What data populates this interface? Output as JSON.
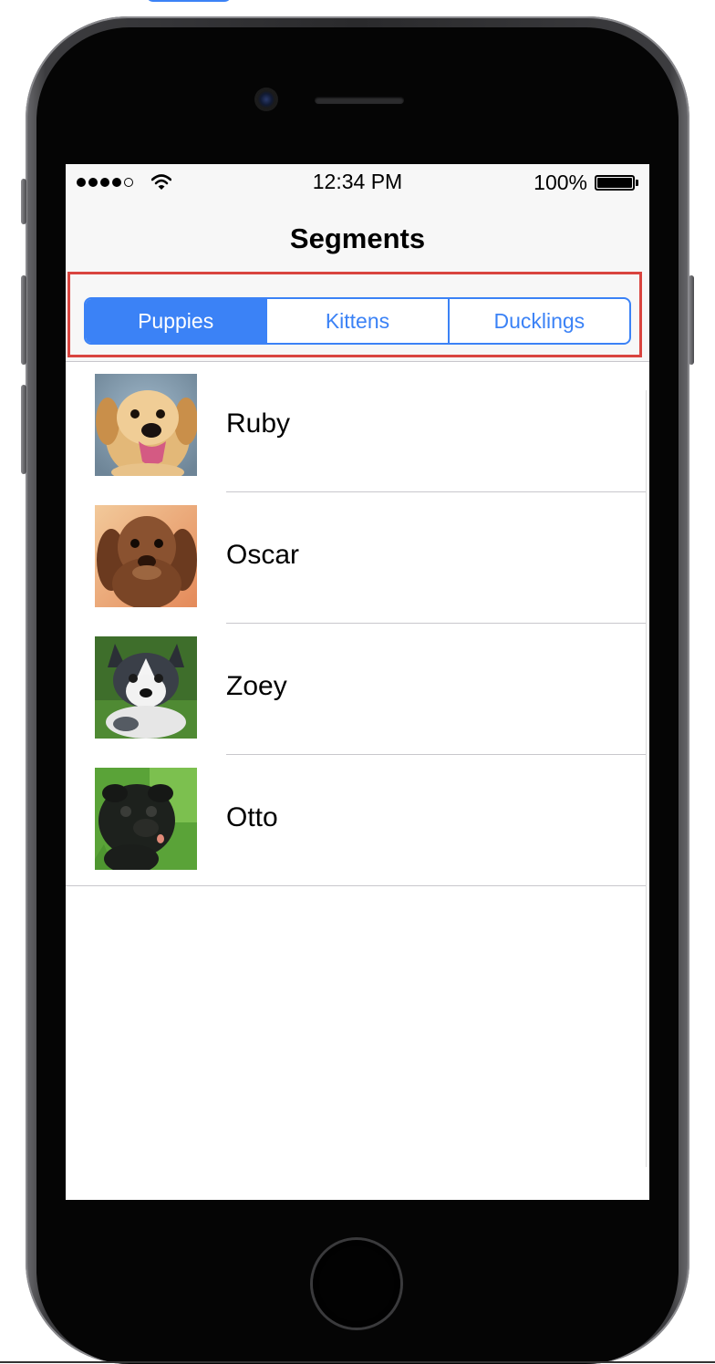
{
  "status_bar": {
    "time": "12:34 PM",
    "battery_percent": "100%",
    "signal_bars_filled": 4,
    "signal_bars_total": 5,
    "wifi_icon": "wifi-icon",
    "battery_icon": "battery-icon"
  },
  "nav": {
    "title": "Segments"
  },
  "segments": {
    "items": [
      {
        "label": "Puppies",
        "selected": true
      },
      {
        "label": "Kittens",
        "selected": false
      },
      {
        "label": "Ducklings",
        "selected": false
      }
    ],
    "highlight_color": "#d9443f",
    "tint_color": "#3b82f6"
  },
  "list": {
    "items": [
      {
        "name": "Ruby",
        "image": "golden-retriever-puppy-photo"
      },
      {
        "name": "Oscar",
        "image": "brown-dachshund-puppy-photo"
      },
      {
        "name": "Zoey",
        "image": "husky-puppy-photo"
      },
      {
        "name": "Otto",
        "image": "black-pug-puppy-photo"
      }
    ]
  }
}
